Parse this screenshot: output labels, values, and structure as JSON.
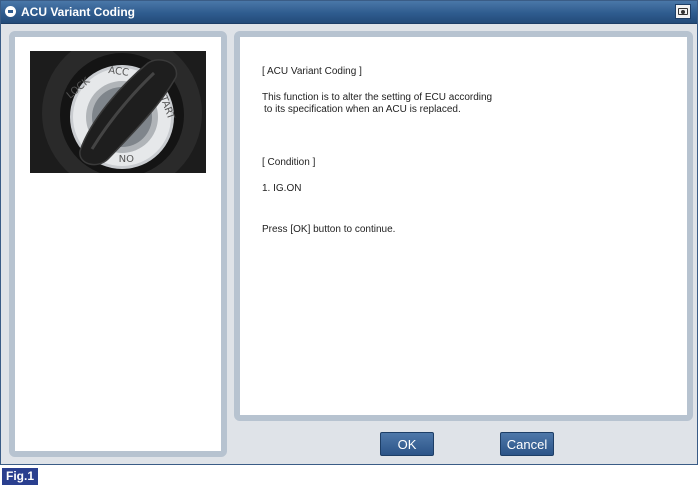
{
  "window": {
    "title": "ACU Variant Coding",
    "camera_icon": "camera-icon"
  },
  "image": {
    "alt": "ignition key switch",
    "ring_labels": [
      "LOCK",
      "ACC",
      "START",
      "ON"
    ]
  },
  "message": {
    "heading": "[ ACU Variant Coding ]",
    "line1": "This function is to alter the setting of ECU according",
    "line2": "to its specification when an ACU is replaced.",
    "condition_heading": "[ Condition ]",
    "condition_item": "1. IG.ON",
    "instruction": "Press [OK] button to continue."
  },
  "buttons": {
    "ok": "OK",
    "cancel": "Cancel"
  },
  "figure_label": "Fig.1",
  "colors": {
    "titlebar": "#2f5c8f",
    "panel_border": "#b7c3d0",
    "button": "#2b5488",
    "figure_label_bg": "#2a3f8f"
  }
}
